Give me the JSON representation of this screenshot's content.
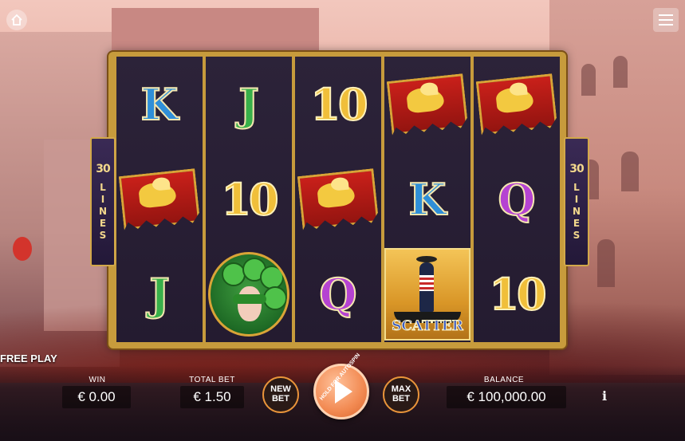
{
  "top": {
    "home_icon": "home-icon",
    "menu_icon": "hamburger-menu-icon"
  },
  "reels": [
    [
      {
        "type": "letter",
        "value": "K",
        "cls": "sym-k"
      },
      {
        "type": "flag"
      },
      {
        "type": "letter",
        "value": "J",
        "cls": "sym-j"
      }
    ],
    [
      {
        "type": "letter",
        "value": "J",
        "cls": "sym-j"
      },
      {
        "type": "ten",
        "value": "10"
      },
      {
        "type": "mask"
      }
    ],
    [
      {
        "type": "ten",
        "value": "10"
      },
      {
        "type": "flag"
      },
      {
        "type": "letter",
        "value": "Q",
        "cls": "sym-q"
      }
    ],
    [
      {
        "type": "flag"
      },
      {
        "type": "letter",
        "value": "K",
        "cls": "sym-k"
      },
      {
        "type": "scatter",
        "value": "SCATTER"
      }
    ],
    [
      {
        "type": "flag"
      },
      {
        "type": "letter",
        "value": "Q",
        "cls": "sym-q"
      },
      {
        "type": "ten",
        "value": "10"
      }
    ]
  ],
  "lines": {
    "count": "30",
    "word": "LINES"
  },
  "free_play": "FREE PLAY",
  "bottom": {
    "win_label": "WIN",
    "win_value": "€ 0.00",
    "total_bet_label": "TOTAL BET",
    "total_bet_value": "€ 1.50",
    "new_bet_line1": "NEW",
    "new_bet_line2": "BET",
    "spin_hold_text": "HOLD FOR AUTOSPIN",
    "max_bet_line1": "MAX",
    "max_bet_line2": "BET",
    "balance_label": "BALANCE",
    "balance_value": "€ 100,000.00",
    "info_label": "i"
  }
}
